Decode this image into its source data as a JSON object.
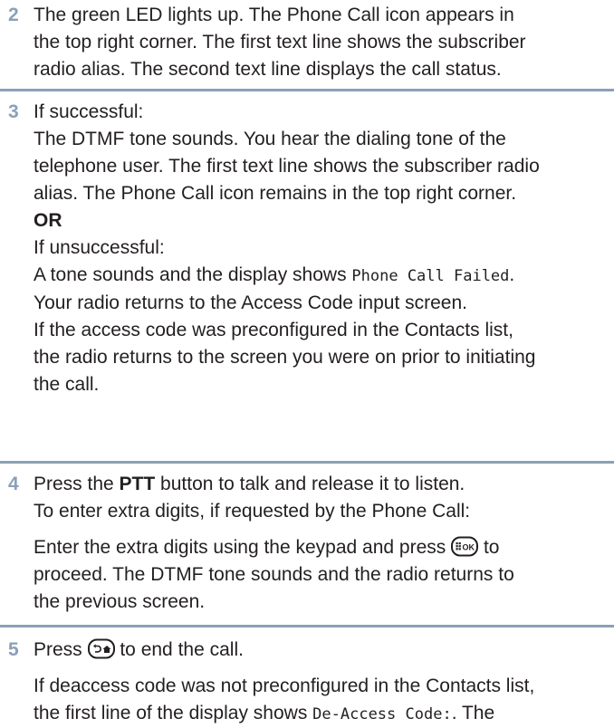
{
  "colors": {
    "step_number": "#8aa0b8",
    "divider": "#8aa0b8",
    "text": "#231f20"
  },
  "steps": [
    {
      "number": "2",
      "lines": [
        "The green LED lights up. The Phone Call icon appears in",
        "the top right corner. The first text line shows the subscriber",
        "radio alias. The second text line displays the call status."
      ]
    },
    {
      "number": "3",
      "lines": [
        "If successful:",
        "The DTMF tone sounds. You hear the dialing tone of the",
        "telephone user. The first text line shows the subscriber radio",
        "alias. The Phone Call icon remains in the top right corner.",
        "OR",
        "If unsuccessful:",
        "A tone sounds and the display shows ",
        "Phone Call Failed",
        ".",
        "Your radio returns to the Access Code input screen.",
        "If the access code was preconfigured in the Contacts list,",
        "the radio returns to the screen you were on prior to initiating",
        "the call."
      ]
    },
    {
      "number": "4",
      "line1_a": "Press the ",
      "line1_ptt": "PTT",
      "line1_b": " button to talk and release it to listen.",
      "line2": "To enter extra digits, if requested by the Phone Call:",
      "line3_a": "Enter the extra digits using the keypad and press ",
      "line3_icon": "menu-ok-button-icon",
      "line3_b": " to",
      "line4": "proceed. The DTMF tone sounds and the radio returns to",
      "line5": "the previous screen."
    },
    {
      "number": "5",
      "line1_a": "Press ",
      "line1_icon": "back-home-button-icon",
      "line1_b": " to end the call.",
      "line2": "If deaccess code was not preconfigured in the Contacts list,",
      "line3_a": "the first line of the display shows ",
      "line3_code": "De-Access Code:",
      "line3_b": ". The"
    }
  ]
}
